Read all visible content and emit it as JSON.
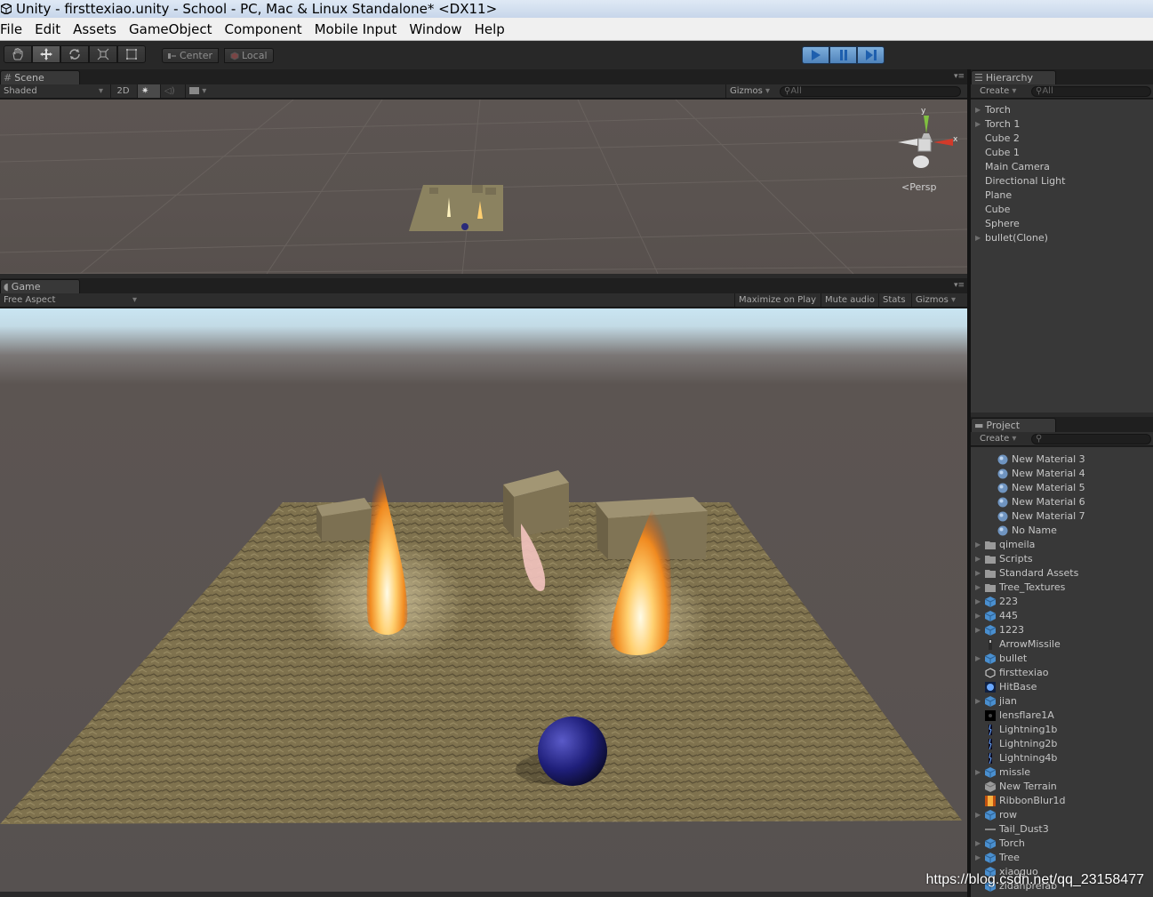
{
  "window": {
    "title": "Unity - firsttexiao.unity - School - PC, Mac & Linux Standalone* <DX11>"
  },
  "menu": [
    "File",
    "Edit",
    "Assets",
    "GameObject",
    "Component",
    "Mobile Input",
    "Window",
    "Help"
  ],
  "toolbar": {
    "pivot_label": "Center",
    "space_label": "Local"
  },
  "scene": {
    "tab_label": "Scene",
    "shading": "Shaded",
    "mode_2d": "2D",
    "gizmos": "Gizmos",
    "search_placeholder": "All",
    "persp_label": "Persp",
    "axis_y": "y",
    "axis_x": "x"
  },
  "game": {
    "tab_label": "Game",
    "aspect": "Free Aspect",
    "maximize": "Maximize on Play",
    "mute": "Mute audio",
    "stats": "Stats",
    "gizmos": "Gizmos"
  },
  "hierarchy": {
    "tab_label": "Hierarchy",
    "create": "Create",
    "search_placeholder": "All",
    "items": [
      {
        "label": "Torch",
        "expandable": true
      },
      {
        "label": "Torch 1",
        "expandable": true
      },
      {
        "label": "Cube 2",
        "expandable": false
      },
      {
        "label": "Cube 1",
        "expandable": false
      },
      {
        "label": "Main Camera",
        "expandable": false
      },
      {
        "label": "Directional Light",
        "expandable": false
      },
      {
        "label": "Plane",
        "expandable": false
      },
      {
        "label": "Cube",
        "expandable": false
      },
      {
        "label": "Sphere",
        "expandable": false
      },
      {
        "label": "bullet(Clone)",
        "expandable": true
      }
    ]
  },
  "project": {
    "tab_label": "Project",
    "create": "Create",
    "items": [
      {
        "label": "New Material 3",
        "icon": "material-icon",
        "expandable": false,
        "indent": 2
      },
      {
        "label": "New Material 4",
        "icon": "material-icon",
        "expandable": false,
        "indent": 2
      },
      {
        "label": "New Material 5",
        "icon": "material-icon",
        "expandable": false,
        "indent": 2
      },
      {
        "label": "New Material 6",
        "icon": "material-icon",
        "expandable": false,
        "indent": 2
      },
      {
        "label": "New Material 7",
        "icon": "material-icon",
        "expandable": false,
        "indent": 2
      },
      {
        "label": "No Name",
        "icon": "material-icon",
        "expandable": false,
        "indent": 2
      },
      {
        "label": "qimeila",
        "icon": "folder-icon",
        "expandable": true,
        "indent": 1
      },
      {
        "label": "Scripts",
        "icon": "folder-icon",
        "expandable": true,
        "indent": 1
      },
      {
        "label": "Standard Assets",
        "icon": "folder-icon",
        "expandable": true,
        "indent": 1
      },
      {
        "label": "Tree_Textures",
        "icon": "folder-icon",
        "expandable": true,
        "indent": 1
      },
      {
        "label": "223",
        "icon": "prefab-icon",
        "expandable": true,
        "indent": 1
      },
      {
        "label": "445",
        "icon": "prefab-icon",
        "expandable": true,
        "indent": 1
      },
      {
        "label": "1223",
        "icon": "prefab-icon",
        "expandable": true,
        "indent": 1
      },
      {
        "label": "ArrowMissile",
        "icon": "texture-dark-icon",
        "expandable": false,
        "indent": 1
      },
      {
        "label": "bullet",
        "icon": "prefab-icon",
        "expandable": true,
        "indent": 1
      },
      {
        "label": "firsttexiao",
        "icon": "unity-scene-icon",
        "expandable": false,
        "indent": 1
      },
      {
        "label": "HitBase",
        "icon": "texture-blue-icon",
        "expandable": false,
        "indent": 1
      },
      {
        "label": "jian",
        "icon": "prefab-icon",
        "expandable": true,
        "indent": 1
      },
      {
        "label": "lensflare1A",
        "icon": "texture-black-icon",
        "expandable": false,
        "indent": 1
      },
      {
        "label": "Lightning1b",
        "icon": "texture-lightning-icon",
        "expandable": false,
        "indent": 1
      },
      {
        "label": "Lightning2b",
        "icon": "texture-lightning-icon",
        "expandable": false,
        "indent": 1
      },
      {
        "label": "Lightning4b",
        "icon": "texture-lightning-icon",
        "expandable": false,
        "indent": 1
      },
      {
        "label": "missle",
        "icon": "prefab-icon",
        "expandable": true,
        "indent": 1
      },
      {
        "label": "New Terrain",
        "icon": "terrain-icon",
        "expandable": false,
        "indent": 1
      },
      {
        "label": "RibbonBlur1d",
        "icon": "texture-orange-icon",
        "expandable": false,
        "indent": 1
      },
      {
        "label": "row",
        "icon": "prefab-icon",
        "expandable": true,
        "indent": 1
      },
      {
        "label": "Tail_Dust3",
        "icon": "texture-line-icon",
        "expandable": false,
        "indent": 1
      },
      {
        "label": "Torch",
        "icon": "prefab-icon",
        "expandable": true,
        "indent": 1
      },
      {
        "label": "Tree",
        "icon": "prefab-icon",
        "expandable": true,
        "indent": 1
      },
      {
        "label": "xiaoguo",
        "icon": "prefab-icon",
        "expandable": false,
        "indent": 1
      },
      {
        "label": "zidanprefab",
        "icon": "prefab-icon",
        "expandable": false,
        "indent": 1
      }
    ]
  },
  "watermark": "https://blog.csdn.net/qq_23158477"
}
